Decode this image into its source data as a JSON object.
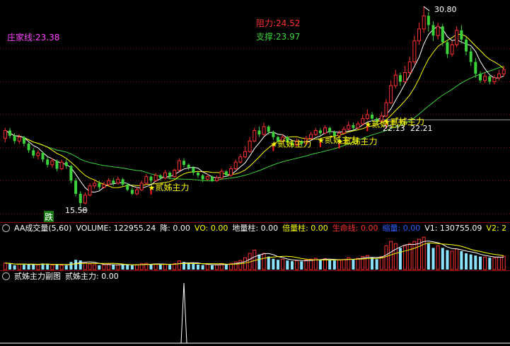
{
  "top_labels": {
    "zhuangjia": "庄家线:23.38",
    "resistance": "阻力:24.52",
    "support": "支撑:23.97",
    "high_price": "30.80",
    "low_price": "15.58",
    "low_marker": "跌",
    "last_close_a": "22.13",
    "last_close_b": "22.21",
    "signal_label": "贰姊主力"
  },
  "volume_bar": {
    "indicator": "AA成交量(5,60)",
    "items": [
      {
        "text": "VOLUME: 122955.24",
        "color": "#ffffff"
      },
      {
        "text": "降: 0.00",
        "color": "#ffffff"
      },
      {
        "text": "VO: 0.00",
        "color": "#ffff00"
      },
      {
        "text": "地量柱: 0.00",
        "color": "#ffffff"
      },
      {
        "text": "倍量柱: 0.00",
        "color": "#ffff00"
      },
      {
        "text": "生命线: 0.00",
        "color": "#ff3030"
      },
      {
        "text": "缩量: 0.00",
        "color": "#3060ff"
      },
      {
        "text": "V1: 130755.09",
        "color": "#ffffff"
      },
      {
        "text": "V2: 2",
        "color": "#ffff00"
      }
    ]
  },
  "sub_bar": {
    "indicator": "贰姊主力副图",
    "value": "贰姊主力: 0.00"
  },
  "colors": {
    "up": "#ff3030",
    "down": "#3cd33c",
    "ma5": "#ffffff",
    "ma10": "#ffff00",
    "ma30": "#3cd33c",
    "signal": "#ffff00",
    "star": "#ff2020",
    "vol_light": "#8be2ff",
    "vol_red": "#ff3030"
  },
  "chart_data": {
    "type": "candlestick",
    "price_range": [
      14.5,
      31.3
    ],
    "high": 30.8,
    "low": 15.58,
    "reference_price": 22.21,
    "resistance": 24.52,
    "support": 23.97,
    "zhuangjia_line": 23.38,
    "candles": [
      [
        20.8,
        21.4,
        21.6,
        20.5
      ],
      [
        21.4,
        21.0,
        21.6,
        20.8
      ],
      [
        21.0,
        20.6,
        21.2,
        20.4
      ],
      [
        20.6,
        20.9,
        21.1,
        20.4
      ],
      [
        20.9,
        20.4,
        21.0,
        20.2
      ],
      [
        20.4,
        19.9,
        20.5,
        19.7
      ],
      [
        19.9,
        19.5,
        20.1,
        19.3
      ],
      [
        19.5,
        19.7,
        19.9,
        19.2
      ],
      [
        19.7,
        19.2,
        19.8,
        19.0
      ],
      [
        19.2,
        18.8,
        19.4,
        18.6
      ],
      [
        18.8,
        19.1,
        19.3,
        18.6
      ],
      [
        19.1,
        18.5,
        19.2,
        18.3
      ],
      [
        18.5,
        19.0,
        19.2,
        18.4
      ],
      [
        19.0,
        18.7,
        19.2,
        18.5
      ],
      [
        18.7,
        17.6,
        18.8,
        17.4
      ],
      [
        17.6,
        16.6,
        17.8,
        16.4
      ],
      [
        16.6,
        15.9,
        16.8,
        15.58
      ],
      [
        15.9,
        16.5,
        16.7,
        15.8
      ],
      [
        16.5,
        17.2,
        17.4,
        16.4
      ],
      [
        17.2,
        17.4,
        17.6,
        17.0
      ],
      [
        17.4,
        17.1,
        17.6,
        16.9
      ],
      [
        17.1,
        17.3,
        17.5,
        17.0
      ],
      [
        17.3,
        17.6,
        17.8,
        17.2
      ],
      [
        17.6,
        17.4,
        17.8,
        17.2
      ],
      [
        17.4,
        17.7,
        17.9,
        17.3
      ],
      [
        17.7,
        17.3,
        17.8,
        17.1
      ],
      [
        17.3,
        16.9,
        17.4,
        16.8
      ],
      [
        16.9,
        16.6,
        17.1,
        16.5
      ],
      [
        16.6,
        16.9,
        17.1,
        16.5
      ],
      [
        16.9,
        17.4,
        17.6,
        16.8
      ],
      [
        17.4,
        17.9,
        18.1,
        17.3
      ],
      [
        17.9,
        17.6,
        18.0,
        17.4
      ],
      [
        17.6,
        18.0,
        18.2,
        17.5
      ],
      [
        18.0,
        17.8,
        18.1,
        17.6
      ],
      [
        17.8,
        18.2,
        18.4,
        17.7
      ],
      [
        18.2,
        17.9,
        18.3,
        17.7
      ],
      [
        17.9,
        18.4,
        18.5,
        17.8
      ],
      [
        18.4,
        19.1,
        19.3,
        18.3
      ],
      [
        19.1,
        18.8,
        19.3,
        18.6
      ],
      [
        18.8,
        18.6,
        18.9,
        18.4
      ],
      [
        18.6,
        18.2,
        18.7,
        18.0
      ],
      [
        18.2,
        18.0,
        18.3,
        17.8
      ],
      [
        18.0,
        17.7,
        18.1,
        17.5
      ],
      [
        17.7,
        17.9,
        18.1,
        17.6
      ],
      [
        17.9,
        17.6,
        18.0,
        17.5
      ],
      [
        17.6,
        17.8,
        18.0,
        17.5
      ],
      [
        17.8,
        18.3,
        18.5,
        17.7
      ],
      [
        18.3,
        18.0,
        18.4,
        17.9
      ],
      [
        18.0,
        18.5,
        18.7,
        17.9
      ],
      [
        18.5,
        19.0,
        19.2,
        18.4
      ],
      [
        19.0,
        19.4,
        19.6,
        18.9
      ],
      [
        19.4,
        19.8,
        20.2,
        19.3
      ],
      [
        19.8,
        20.6,
        20.9,
        19.7
      ],
      [
        20.6,
        21.4,
        21.6,
        20.5
      ],
      [
        21.4,
        21.1,
        21.7,
        20.9
      ],
      [
        21.1,
        21.7,
        22.0,
        21.0
      ],
      [
        21.7,
        21.3,
        21.8,
        21.1
      ],
      [
        21.3,
        20.9,
        21.4,
        20.7
      ],
      [
        20.9,
        20.6,
        21.0,
        20.4
      ],
      [
        20.6,
        20.9,
        21.1,
        20.5
      ],
      [
        20.9,
        20.5,
        21.0,
        20.3
      ],
      [
        20.5,
        20.3,
        20.6,
        20.1
      ],
      [
        20.3,
        20.6,
        20.8,
        20.2
      ],
      [
        20.6,
        20.4,
        20.7,
        20.2
      ],
      [
        20.4,
        20.8,
        21.0,
        20.3
      ],
      [
        20.8,
        21.1,
        21.3,
        20.7
      ],
      [
        21.1,
        21.4,
        21.6,
        21.0
      ],
      [
        21.4,
        21.2,
        21.6,
        21.0
      ],
      [
        21.2,
        21.6,
        21.8,
        21.1
      ],
      [
        21.6,
        21.3,
        21.7,
        21.1
      ],
      [
        21.3,
        21.0,
        21.4,
        20.8
      ],
      [
        21.0,
        21.2,
        21.4,
        20.9
      ],
      [
        21.2,
        21.5,
        21.7,
        21.1
      ],
      [
        21.5,
        21.8,
        22.1,
        21.4
      ],
      [
        21.8,
        21.6,
        22.0,
        21.4
      ],
      [
        21.6,
        21.9,
        22.1,
        21.5
      ],
      [
        21.9,
        22.3,
        22.6,
        21.8
      ],
      [
        22.3,
        22.6,
        23.0,
        22.2
      ],
      [
        22.6,
        22.3,
        22.8,
        22.1
      ],
      [
        22.3,
        22.1,
        22.4,
        21.9
      ],
      [
        22.1,
        22.5,
        22.8,
        22.0
      ],
      [
        22.5,
        23.5,
        23.8,
        22.4
      ],
      [
        23.5,
        24.8,
        25.2,
        23.4
      ],
      [
        24.8,
        25.6,
        26.0,
        24.6
      ],
      [
        25.6,
        25.1,
        25.8,
        24.8
      ],
      [
        25.1,
        25.8,
        26.3,
        25.0
      ],
      [
        25.8,
        26.6,
        27.0,
        25.6
      ],
      [
        26.6,
        28.2,
        28.6,
        26.4
      ],
      [
        28.2,
        29.1,
        29.6,
        27.9
      ],
      [
        29.1,
        30.1,
        30.8,
        28.8
      ],
      [
        30.1,
        29.4,
        30.4,
        28.9
      ],
      [
        29.4,
        28.6,
        29.7,
        28.2
      ],
      [
        28.6,
        29.3,
        29.6,
        28.3
      ],
      [
        29.3,
        28.1,
        29.5,
        27.8
      ],
      [
        28.1,
        27.2,
        28.3,
        26.9
      ],
      [
        27.2,
        27.9,
        28.2,
        27.0
      ],
      [
        27.9,
        29.0,
        29.3,
        27.7
      ],
      [
        29.0,
        28.3,
        29.4,
        28.0
      ],
      [
        28.3,
        27.4,
        28.5,
        27.1
      ],
      [
        27.4,
        26.6,
        27.7,
        26.3
      ],
      [
        26.6,
        25.7,
        26.9,
        25.4
      ],
      [
        25.7,
        25.2,
        25.9,
        25.0
      ],
      [
        25.2,
        25.5,
        25.8,
        25.0
      ],
      [
        25.5,
        25.1,
        25.7,
        24.9
      ],
      [
        25.1,
        25.4,
        25.6,
        24.9
      ],
      [
        25.4,
        25.7,
        26.0,
        25.2
      ],
      [
        25.7,
        26.0,
        26.3,
        25.5
      ]
    ],
    "volume_max": 320000,
    "volumes": [
      60000,
      55000,
      40000,
      50000,
      45000,
      52000,
      48000,
      44000,
      56000,
      50000,
      42000,
      46000,
      40000,
      38000,
      70000,
      90000,
      85000,
      60000,
      52000,
      46000,
      40000,
      44000,
      50000,
      46000,
      42000,
      48000,
      44000,
      40000,
      46000,
      54000,
      58000,
      50000,
      52000,
      46000,
      50000,
      44000,
      56000,
      80000,
      70000,
      60000,
      52000,
      46000,
      42000,
      48000,
      40000,
      44000,
      56000,
      48000,
      58000,
      70000,
      84000,
      110000,
      150000,
      180000,
      140000,
      150000,
      120000,
      100000,
      90000,
      96000,
      84000,
      78000,
      82000,
      76000,
      88000,
      96000,
      104000,
      92000,
      100000,
      90000,
      84000,
      88000,
      94000,
      110000,
      98000,
      104000,
      120000,
      130000,
      110000,
      96000,
      120000,
      220000,
      260000,
      240000,
      200000,
      220000,
      240000,
      260000,
      280000,
      300000,
      240000,
      200000,
      220000,
      200000,
      180000,
      170000,
      190000,
      170000,
      150000,
      140000,
      130000,
      120000,
      116000,
      110000,
      108000,
      116000,
      122955
    ],
    "signal_points": [
      31,
      57,
      67,
      71,
      77,
      81
    ],
    "signal_spike_index": 38,
    "signal_spike_value": 1.0
  }
}
